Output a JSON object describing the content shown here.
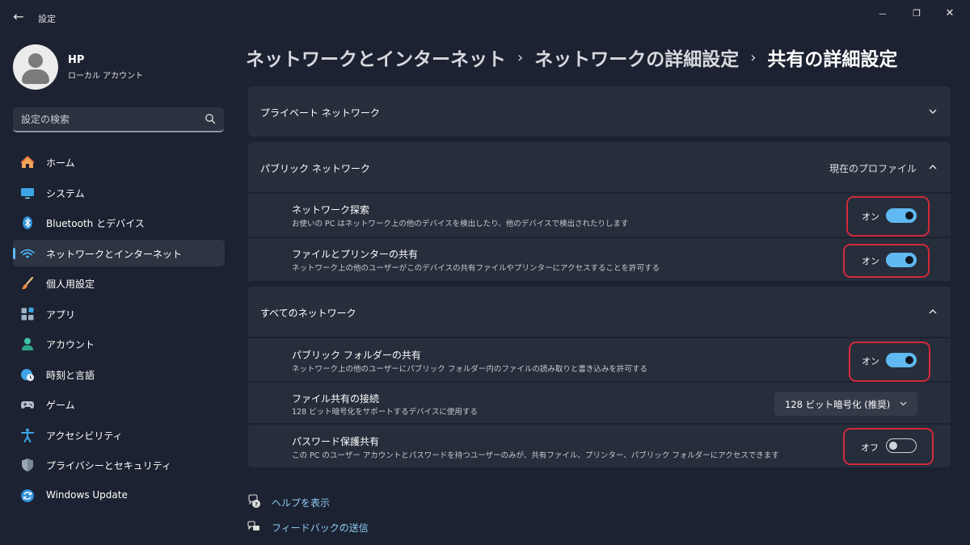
{
  "window": {
    "app_title": "設定",
    "back_glyph": "←",
    "minimize_glyph": "—",
    "restore_glyph": "❐",
    "close_glyph": "✕"
  },
  "user": {
    "name": "HP",
    "account_type": "ローカル アカウント"
  },
  "search": {
    "placeholder": "設定の検索"
  },
  "nav": {
    "items": [
      {
        "label": "ホーム",
        "icon": "home-icon"
      },
      {
        "label": "システム",
        "icon": "monitor-icon"
      },
      {
        "label": "Bluetooth とデバイス",
        "icon": "bluetooth-icon"
      },
      {
        "label": "ネットワークとインターネット",
        "icon": "wifi-icon",
        "active": true
      },
      {
        "label": "個人用設定",
        "icon": "brush-icon"
      },
      {
        "label": "アプリ",
        "icon": "apps-icon"
      },
      {
        "label": "アカウント",
        "icon": "person-icon"
      },
      {
        "label": "時刻と言語",
        "icon": "clock-globe-icon"
      },
      {
        "label": "ゲーム",
        "icon": "gamepad-icon"
      },
      {
        "label": "アクセシビリティ",
        "icon": "accessibility-icon"
      },
      {
        "label": "プライバシーとセキュリティ",
        "icon": "shield-icon"
      },
      {
        "label": "Windows Update",
        "icon": "update-icon"
      }
    ]
  },
  "breadcrumb": {
    "items": [
      "ネットワークとインターネット",
      "ネットワークの詳細設定",
      "共有の詳細設定"
    ],
    "separator": "›"
  },
  "private_network": {
    "title": "プライベート ネットワーク"
  },
  "public_network": {
    "title": "パブリック ネットワーク",
    "profile_label": "現在のプロファイル",
    "network_discovery": {
      "title": "ネットワーク探索",
      "description": "お使いの PC はネットワーク上の他のデバイスを検出したり、他のデバイスで検出されたりします",
      "state": "オン"
    },
    "file_printer_sharing": {
      "title": "ファイルとプリンターの共有",
      "description": "ネットワーク上の他のユーザーがこのデバイスの共有ファイルやプリンターにアクセスすることを許可する",
      "state": "オン"
    }
  },
  "all_networks": {
    "title": "すべてのネットワーク",
    "public_folder_sharing": {
      "title": "パブリック フォルダーの共有",
      "description": "ネットワーク上の他のユーザーにパブリック フォルダー内のファイルの読み取りと書き込みを許可する",
      "state": "オン"
    },
    "file_sharing_connections": {
      "title": "ファイル共有の接続",
      "description": "128 ビット暗号化をサポートするデバイスに使用する",
      "selected": "128 ビット暗号化 (推奨)"
    },
    "password_protected_sharing": {
      "title": "パスワード保護共有",
      "description": "この PC のユーザー アカウントとパスワードを持つユーザーのみが、共有ファイル、プリンター、パブリック フォルダーにアクセスできます",
      "state": "オフ"
    }
  },
  "footer": {
    "help": "ヘルプを表示",
    "feedback": "フィードバックの送信"
  },
  "colors": {
    "background": "#1c2231",
    "card": "#272e3c",
    "accent": "#60b9f0",
    "link": "#8fcdf6",
    "highlight": "#d32a3a"
  }
}
